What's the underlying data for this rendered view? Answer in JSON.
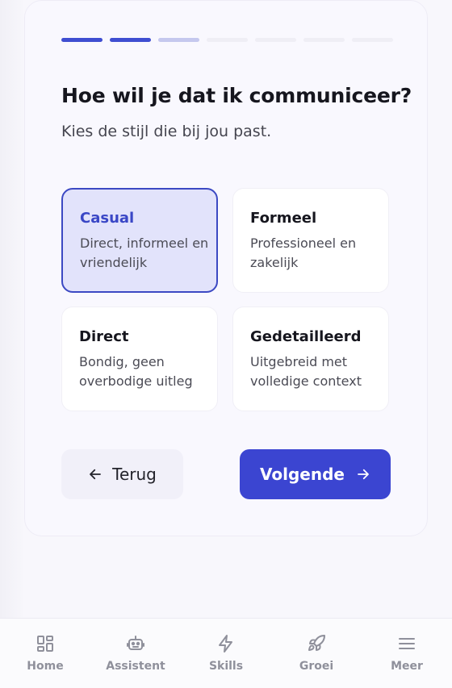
{
  "progress": {
    "total_steps": 7,
    "completed": 2,
    "current": 3
  },
  "header": {
    "title": "Hoe wil je dat ik communiceer?",
    "subtitle": "Kies de stijl die bij jou past."
  },
  "options": [
    {
      "title": "Casual",
      "desc": "Direct, informeel en vriendelijk",
      "selected": true
    },
    {
      "title": "Formeel",
      "desc": "Professioneel en zakelijk",
      "selected": false
    },
    {
      "title": "Direct",
      "desc": "Bondig, geen overbodige uitleg",
      "selected": false
    },
    {
      "title": "Gedetailleerd",
      "desc": "Uitgebreid met volledige context",
      "selected": false
    }
  ],
  "actions": {
    "back_label": "Terug",
    "next_label": "Volgende"
  },
  "tabbar": {
    "items": [
      {
        "label": "Home",
        "icon": "dashboard-icon"
      },
      {
        "label": "Assistent",
        "icon": "robot-icon"
      },
      {
        "label": "Skills",
        "icon": "lightning-icon"
      },
      {
        "label": "Groei",
        "icon": "rocket-icon"
      },
      {
        "label": "Meer",
        "icon": "menu-icon"
      }
    ]
  },
  "colors": {
    "accent": "#3b45d1",
    "selected_bg": "#e2e3fb",
    "progress_current": "#c5c8ee",
    "progress_pending": "#efeef5"
  }
}
